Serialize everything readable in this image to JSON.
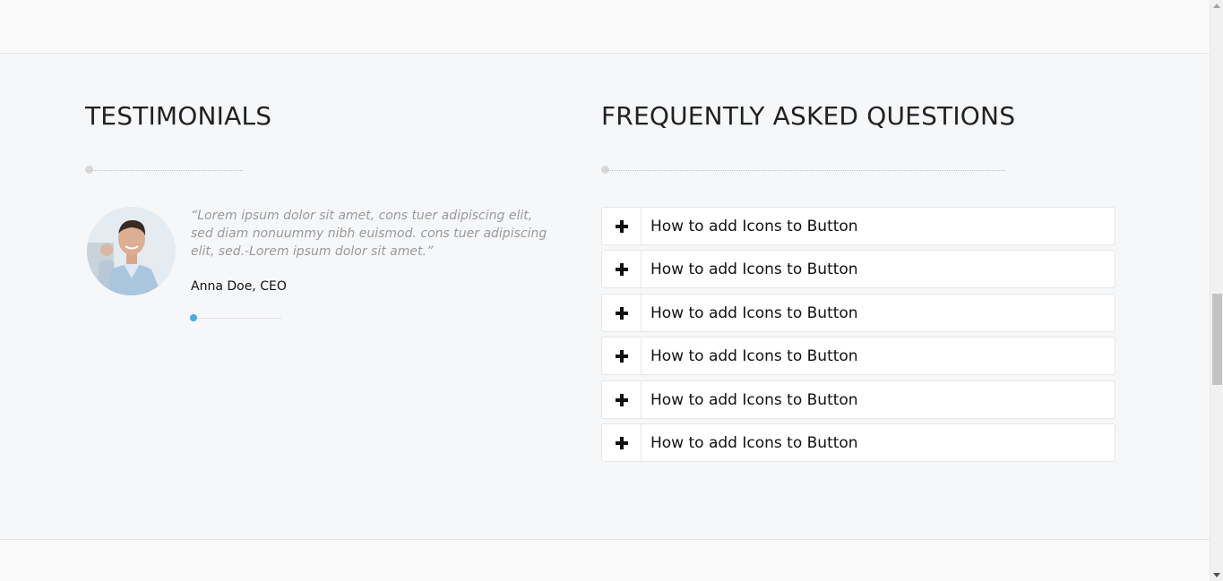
{
  "testimonials": {
    "heading": "TESTIMONIALS",
    "quote": "“Lorem ipsum dolor sit amet, cons tuer adipiscing elit, sed diam nonuummy nibh euismod. cons tuer adipiscing elit, sed.-Lorem ipsum dolor sit amet.”",
    "author": "Anna Doe, CEO",
    "slider_active_color": "#3bb1e6"
  },
  "faq": {
    "heading": "FREQUENTLY ASKED QUESTIONS",
    "items": [
      {
        "question": "How to add Icons to Button",
        "icon": "plus-icon"
      },
      {
        "question": "How to add Icons to Button",
        "icon": "plus-icon"
      },
      {
        "question": "How to add Icons to Button",
        "icon": "plus-icon"
      },
      {
        "question": "How to add Icons to Button",
        "icon": "plus-icon"
      },
      {
        "question": "How to add Icons to Button",
        "icon": "plus-icon"
      },
      {
        "question": "How to add Icons to Button",
        "icon": "plus-icon"
      }
    ]
  }
}
